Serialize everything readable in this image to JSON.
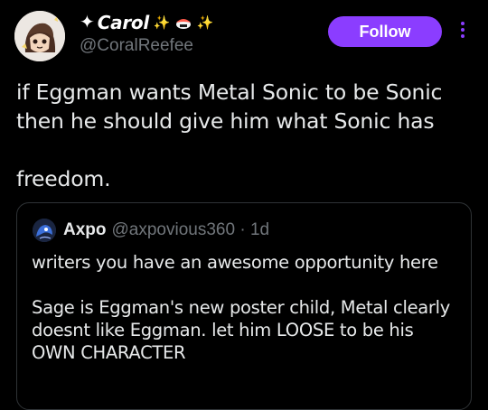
{
  "post": {
    "author": {
      "display_name": "Carol",
      "handle": "@CoralReefee",
      "avatar_icon": "avatar-illustration"
    },
    "follow_label": "Follow",
    "more_icon": "more-vertical-icon",
    "text_lines": [
      "if Eggman wants Metal Sonic to be Sonic",
      "then he should give him what Sonic has",
      "freedom."
    ]
  },
  "quote": {
    "author": {
      "name": "Axpo",
      "handle": "@axpovious360",
      "time": "1d",
      "avatar_icon": "avatar-icon"
    },
    "paragraphs": [
      [
        "writers you have an awesome opportunity here"
      ],
      [
        "Sage is Eggman's new poster child, Metal clearly",
        "doesnt like Eggman. let him LOOSE to be his",
        "OWN CHARACTER"
      ]
    ]
  },
  "colors": {
    "background": "#000000",
    "accent": "#8b3dff",
    "text_primary": "#e7e9ea",
    "text_secondary": "#71767b",
    "border": "#2f3336"
  }
}
